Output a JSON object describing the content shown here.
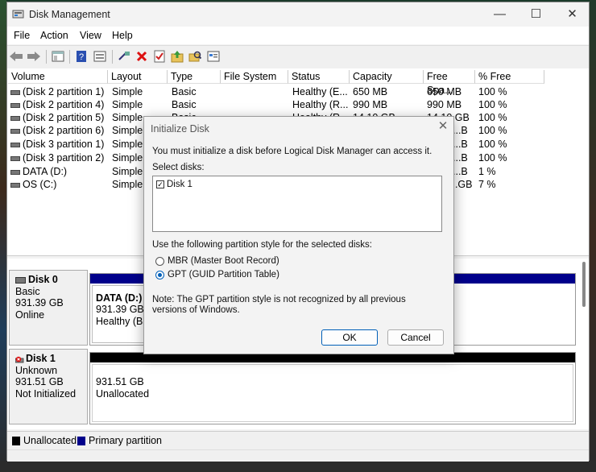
{
  "window": {
    "title": "Disk Management",
    "caption": {
      "minimize": "—",
      "maximize": "☐",
      "close": "✕"
    }
  },
  "menu": [
    "File",
    "Action",
    "View",
    "Help"
  ],
  "toolbar_icons": [
    "back-arrow-icon",
    "forward-arrow-icon",
    "console-tree-icon",
    "help-icon",
    "properties-icon",
    "connect-icon",
    "delete-icon",
    "check-icon",
    "folder-up-icon",
    "folder-search-icon",
    "settings-panel-icon"
  ],
  "columns": [
    "Volume",
    "Layout",
    "Type",
    "File System",
    "Status",
    "Capacity",
    "Free Spa...",
    "% Free"
  ],
  "volumes": [
    {
      "volume": "(Disk 2 partition 1)",
      "layout": "Simple",
      "type": "Basic",
      "fs": "",
      "status": "Healthy (E...",
      "capacity": "650 MB",
      "free": "650 MB",
      "pct": "100 %"
    },
    {
      "volume": "(Disk 2 partition 4)",
      "layout": "Simple",
      "type": "Basic",
      "fs": "",
      "status": "Healthy (R...",
      "capacity": "990 MB",
      "free": "990 MB",
      "pct": "100 %"
    },
    {
      "volume": "(Disk 2 partition 5)",
      "layout": "Simple",
      "type": "Basic",
      "fs": "",
      "status": "Healthy (R...",
      "capacity": "14.10 GB",
      "free": "14.10 GB",
      "pct": "100 %"
    },
    {
      "volume": "(Disk 2 partition 6)",
      "layout": "Simple",
      "type": "",
      "fs": "",
      "status": "",
      "capacity": "",
      "free": "...B",
      "pct": "100 %"
    },
    {
      "volume": "(Disk 3 partition 1)",
      "layout": "Simple",
      "type": "",
      "fs": "",
      "status": "",
      "capacity": "",
      "free": "...B",
      "pct": "100 %"
    },
    {
      "volume": "(Disk 3 partition 2)",
      "layout": "Simple",
      "type": "",
      "fs": "",
      "status": "",
      "capacity": "",
      "free": "...B",
      "pct": "100 %"
    },
    {
      "volume": "DATA (D:)",
      "layout": "Simple",
      "type": "",
      "fs": "",
      "status": "",
      "capacity": "",
      "free": "...B",
      "pct": "1 %"
    },
    {
      "volume": "OS (C:)",
      "layout": "Simple",
      "type": "",
      "fs": "",
      "status": "",
      "capacity": "",
      "free": "...GB",
      "pct": "7 %"
    }
  ],
  "disks": [
    {
      "name": "Disk 0",
      "type": "Basic",
      "size": "931.39 GB",
      "state": "Online",
      "part_name": "DATA (D:)",
      "part_size": "931.39 GB N",
      "part_status": "Healthy (Bas"
    },
    {
      "name": "Disk 1",
      "type": "Unknown",
      "size": "931.51 GB",
      "state": "Not Initialized",
      "part_size": "931.51 GB",
      "part_status": "Unallocated"
    }
  ],
  "legend": [
    {
      "label": "Unallocated",
      "color": "#000000"
    },
    {
      "label": "Primary partition",
      "color": "#00008b"
    }
  ],
  "dialog": {
    "title": "Initialize Disk",
    "close": "✕",
    "intro": "You must initialize a disk before Logical Disk Manager can access it.",
    "select_label": "Select disks:",
    "disk_item": "Disk 1",
    "disk_checked": true,
    "style_label": "Use the following partition style for the selected disks:",
    "mbr": "MBR (Master Boot Record)",
    "gpt": "GPT (GUID Partition Table)",
    "selected_style": "GPT",
    "note": "Note: The GPT partition style is not recognized by all previous versions of Windows.",
    "ok": "OK",
    "cancel": "Cancel"
  }
}
